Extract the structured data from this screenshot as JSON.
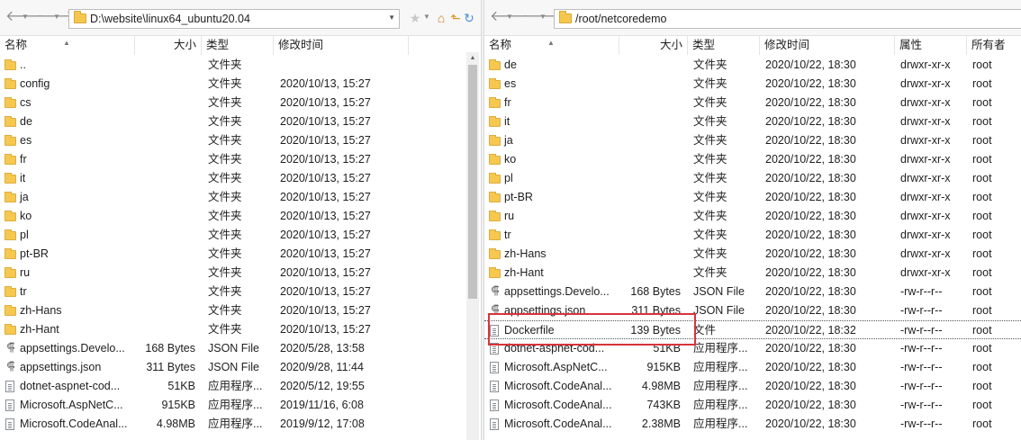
{
  "left": {
    "path": "D:\\website\\linux64_ubuntu20.04",
    "columns": [
      "名称",
      "大小",
      "类型",
      "修改时间"
    ],
    "rows": [
      {
        "name": "..",
        "size": "",
        "type": "文件夹",
        "mtime": "",
        "icon": "folder-icon"
      },
      {
        "name": "config",
        "size": "",
        "type": "文件夹",
        "mtime": "2020/10/13, 15:27",
        "icon": "folder-icon"
      },
      {
        "name": "cs",
        "size": "",
        "type": "文件夹",
        "mtime": "2020/10/13, 15:27",
        "icon": "folder-icon"
      },
      {
        "name": "de",
        "size": "",
        "type": "文件夹",
        "mtime": "2020/10/13, 15:27",
        "icon": "folder-icon"
      },
      {
        "name": "es",
        "size": "",
        "type": "文件夹",
        "mtime": "2020/10/13, 15:27",
        "icon": "folder-icon"
      },
      {
        "name": "fr",
        "size": "",
        "type": "文件夹",
        "mtime": "2020/10/13, 15:27",
        "icon": "folder-icon"
      },
      {
        "name": "it",
        "size": "",
        "type": "文件夹",
        "mtime": "2020/10/13, 15:27",
        "icon": "folder-icon"
      },
      {
        "name": "ja",
        "size": "",
        "type": "文件夹",
        "mtime": "2020/10/13, 15:27",
        "icon": "folder-icon"
      },
      {
        "name": "ko",
        "size": "",
        "type": "文件夹",
        "mtime": "2020/10/13, 15:27",
        "icon": "folder-icon"
      },
      {
        "name": "pl",
        "size": "",
        "type": "文件夹",
        "mtime": "2020/10/13, 15:27",
        "icon": "folder-icon"
      },
      {
        "name": "pt-BR",
        "size": "",
        "type": "文件夹",
        "mtime": "2020/10/13, 15:27",
        "icon": "folder-icon"
      },
      {
        "name": "ru",
        "size": "",
        "type": "文件夹",
        "mtime": "2020/10/13, 15:27",
        "icon": "folder-icon"
      },
      {
        "name": "tr",
        "size": "",
        "type": "文件夹",
        "mtime": "2020/10/13, 15:27",
        "icon": "folder-icon"
      },
      {
        "name": "zh-Hans",
        "size": "",
        "type": "文件夹",
        "mtime": "2020/10/13, 15:27",
        "icon": "folder-icon"
      },
      {
        "name": "zh-Hant",
        "size": "",
        "type": "文件夹",
        "mtime": "2020/10/13, 15:27",
        "icon": "folder-icon"
      },
      {
        "name": "appsettings.Develo...",
        "size": "168 Bytes",
        "type": "JSON File",
        "mtime": "2020/5/28, 13:58",
        "icon": "json-file-icon"
      },
      {
        "name": "appsettings.json",
        "size": "311 Bytes",
        "type": "JSON File",
        "mtime": "2020/9/28, 11:44",
        "icon": "json-file-icon"
      },
      {
        "name": "dotnet-aspnet-cod...",
        "size": "51KB",
        "type": "应用程序...",
        "mtime": "2020/5/12, 19:55",
        "icon": "file-icon"
      },
      {
        "name": "Microsoft.AspNetC...",
        "size": "915KB",
        "type": "应用程序...",
        "mtime": "2019/11/16, 6:08",
        "icon": "file-icon"
      },
      {
        "name": "Microsoft.CodeAnal...",
        "size": "4.98MB",
        "type": "应用程序...",
        "mtime": "2019/9/12, 17:08",
        "icon": "file-icon"
      }
    ]
  },
  "right": {
    "path": "/root/netcoredemo",
    "columns": [
      "名称",
      "大小",
      "类型",
      "修改时间",
      "属性",
      "所有者"
    ],
    "rows": [
      {
        "name": "de",
        "size": "",
        "type": "文件夹",
        "mtime": "2020/10/22, 18:30",
        "perm": "drwxr-xr-x",
        "owner": "root",
        "icon": "folder-icon"
      },
      {
        "name": "es",
        "size": "",
        "type": "文件夹",
        "mtime": "2020/10/22, 18:30",
        "perm": "drwxr-xr-x",
        "owner": "root",
        "icon": "folder-icon"
      },
      {
        "name": "fr",
        "size": "",
        "type": "文件夹",
        "mtime": "2020/10/22, 18:30",
        "perm": "drwxr-xr-x",
        "owner": "root",
        "icon": "folder-icon"
      },
      {
        "name": "it",
        "size": "",
        "type": "文件夹",
        "mtime": "2020/10/22, 18:30",
        "perm": "drwxr-xr-x",
        "owner": "root",
        "icon": "folder-icon"
      },
      {
        "name": "ja",
        "size": "",
        "type": "文件夹",
        "mtime": "2020/10/22, 18:30",
        "perm": "drwxr-xr-x",
        "owner": "root",
        "icon": "folder-icon"
      },
      {
        "name": "ko",
        "size": "",
        "type": "文件夹",
        "mtime": "2020/10/22, 18:30",
        "perm": "drwxr-xr-x",
        "owner": "root",
        "icon": "folder-icon"
      },
      {
        "name": "pl",
        "size": "",
        "type": "文件夹",
        "mtime": "2020/10/22, 18:30",
        "perm": "drwxr-xr-x",
        "owner": "root",
        "icon": "folder-icon"
      },
      {
        "name": "pt-BR",
        "size": "",
        "type": "文件夹",
        "mtime": "2020/10/22, 18:30",
        "perm": "drwxr-xr-x",
        "owner": "root",
        "icon": "folder-icon"
      },
      {
        "name": "ru",
        "size": "",
        "type": "文件夹",
        "mtime": "2020/10/22, 18:30",
        "perm": "drwxr-xr-x",
        "owner": "root",
        "icon": "folder-icon"
      },
      {
        "name": "tr",
        "size": "",
        "type": "文件夹",
        "mtime": "2020/10/22, 18:30",
        "perm": "drwxr-xr-x",
        "owner": "root",
        "icon": "folder-icon"
      },
      {
        "name": "zh-Hans",
        "size": "",
        "type": "文件夹",
        "mtime": "2020/10/22, 18:30",
        "perm": "drwxr-xr-x",
        "owner": "root",
        "icon": "folder-icon"
      },
      {
        "name": "zh-Hant",
        "size": "",
        "type": "文件夹",
        "mtime": "2020/10/22, 18:30",
        "perm": "drwxr-xr-x",
        "owner": "root",
        "icon": "folder-icon"
      },
      {
        "name": "appsettings.Develo...",
        "size": "168 Bytes",
        "type": "JSON File",
        "mtime": "2020/10/22, 18:30",
        "perm": "-rw-r--r--",
        "owner": "root",
        "icon": "json-file-icon"
      },
      {
        "name": "appsettings.json",
        "size": "311 Bytes",
        "type": "JSON File",
        "mtime": "2020/10/22, 18:30",
        "perm": "-rw-r--r--",
        "owner": "root",
        "icon": "json-file-icon"
      },
      {
        "name": "Dockerfile",
        "size": "139 Bytes",
        "type": "文件",
        "mtime": "2020/10/22, 18:32",
        "perm": "-rw-r--r--",
        "owner": "root",
        "icon": "file-icon"
      },
      {
        "name": "dotnet-aspnet-cod...",
        "size": "51KB",
        "type": "应用程序...",
        "mtime": "2020/10/22, 18:30",
        "perm": "-rw-r--r--",
        "owner": "root",
        "icon": "file-icon"
      },
      {
        "name": "Microsoft.AspNetC...",
        "size": "915KB",
        "type": "应用程序...",
        "mtime": "2020/10/22, 18:30",
        "perm": "-rw-r--r--",
        "owner": "root",
        "icon": "file-icon"
      },
      {
        "name": "Microsoft.CodeAnal...",
        "size": "4.98MB",
        "type": "应用程序...",
        "mtime": "2020/10/22, 18:30",
        "perm": "-rw-r--r--",
        "owner": "root",
        "icon": "file-icon"
      },
      {
        "name": "Microsoft.CodeAnal...",
        "size": "743KB",
        "type": "应用程序...",
        "mtime": "2020/10/22, 18:30",
        "perm": "-rw-r--r--",
        "owner": "root",
        "icon": "file-icon"
      },
      {
        "name": "Microsoft.CodeAnal...",
        "size": "2.38MB",
        "type": "应用程序...",
        "mtime": "2020/10/22, 18:30",
        "perm": "-rw-r--r--",
        "owner": "root",
        "icon": "file-icon"
      }
    ],
    "highlighted_row": 14
  },
  "colors": {
    "highlight": "#d9333b",
    "folder": "#f6c850"
  }
}
